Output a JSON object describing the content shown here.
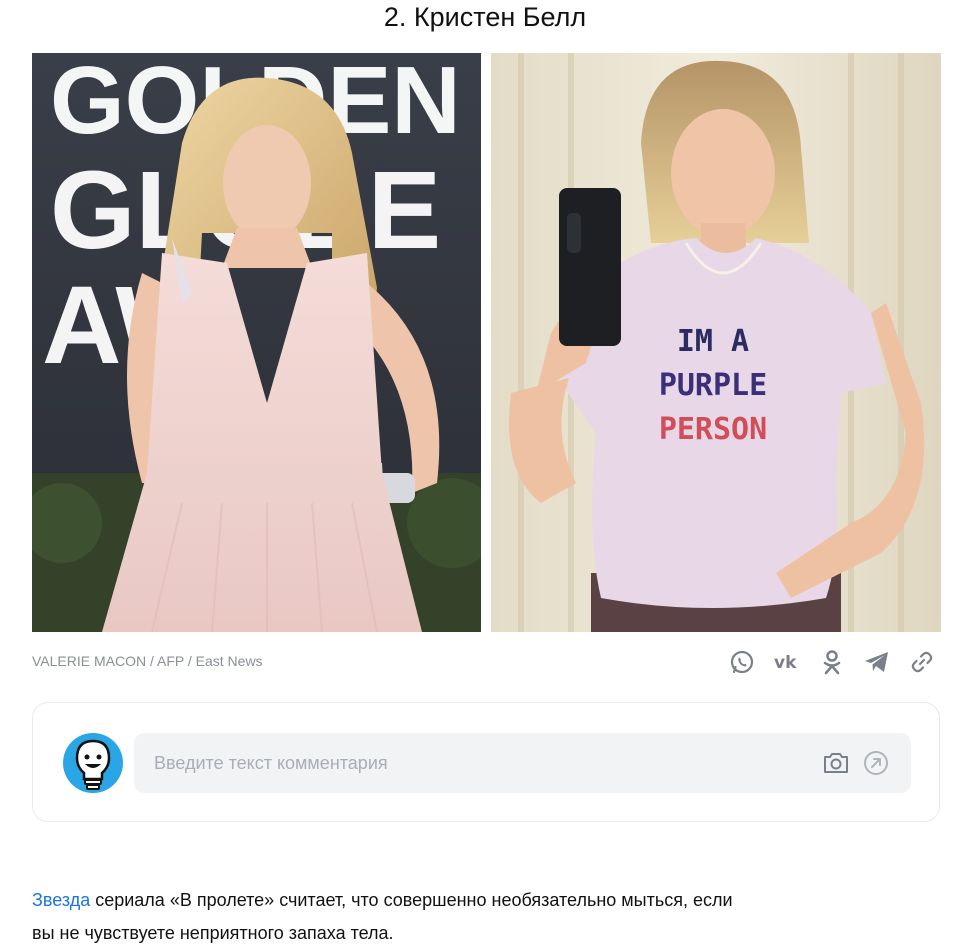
{
  "heading": "2. Кристен Белл",
  "photos": {
    "left": {
      "backdrop_text": [
        "GOLDEN",
        "GLOBE",
        "AW"
      ],
      "backdrop_color": "#3b3f4a",
      "dress_color": "#f1d6d3",
      "hair_color": "#e3c58d"
    },
    "right": {
      "shirt_lines": [
        "IM A",
        "PURPLE",
        "PERSON"
      ],
      "shirt_color": "#e8d7e6",
      "curtain_color": "#ece5d3"
    }
  },
  "credit": "VALERIE MACON / AFP / East News",
  "share": {
    "icons": [
      "whatsapp-icon",
      "vk-icon",
      "odnoklassniki-icon",
      "telegram-icon",
      "link-icon"
    ],
    "icon_color": "#7a8089"
  },
  "comment": {
    "placeholder": "Введите текст комментария",
    "avatar_color": "#2aa5e5"
  },
  "article": {
    "link_text": "Звезда",
    "text_line1": " сериала «В пролете» считает, что совершенно необязательно мыться, если",
    "text_line2": "вы не чувствуете неприятного запаха тела."
  },
  "colors": {
    "link": "#1a73e8",
    "muted": "#8a8f99"
  }
}
